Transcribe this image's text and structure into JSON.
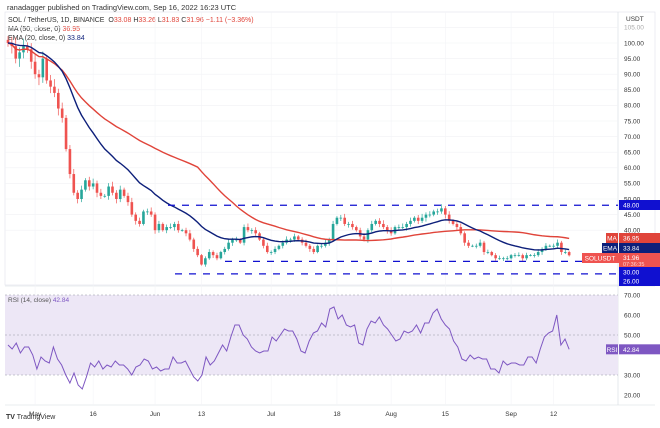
{
  "header": {
    "published": "ranadagger published on TradingView.com, Sep 16, 2022 16:23 UTC",
    "symbol": "SOL / TetherUS, 1D, BINANCE",
    "o_label": "O",
    "o": "33.08",
    "h_label": "H",
    "h": "33.26",
    "l_label": "L",
    "l": "31.83",
    "c_label": "C",
    "c": "31.96",
    "change": "−1.11 (−3.36%)",
    "ma_legend": "MA (50, close, 0)",
    "ma_value": "36.95",
    "ema_legend": "EMA (20, close, 0)",
    "ema_value": "33.84"
  },
  "footer": {
    "brand": "TradingView"
  },
  "colors": {
    "up": "#26a69a",
    "down": "#ef5350",
    "ma": "#e0443a",
    "ema": "#0d1f7a",
    "level": "#1010d0",
    "rsi": "#7e57c2",
    "rsi_band": "#ede7f6"
  },
  "chart_data": [
    {
      "type": "candlestick",
      "title": "SOL / TetherUS, 1D, BINANCE",
      "ylabel": "USDT",
      "ylim": [
        26,
        107
      ],
      "y_ticks": [
        "105.00",
        "100.00",
        "95.00",
        "90.00",
        "85.00",
        "80.00",
        "75.00",
        "70.00",
        "65.00",
        "60.00",
        "55.00",
        "50.00",
        "45.00",
        "40.00"
      ],
      "x_ticks": [
        "May",
        "16",
        "Jun",
        "13",
        "Jul",
        "18",
        "Aug",
        "15",
        "Sep",
        "12"
      ],
      "closes": [
        100,
        99,
        95,
        97,
        99,
        98,
        94,
        90,
        89,
        95,
        88,
        86,
        84,
        79,
        76,
        66,
        58,
        52,
        50,
        53,
        56,
        54,
        55,
        52,
        51,
        51,
        54,
        52,
        50,
        53,
        51,
        49,
        45,
        43,
        42,
        46,
        46,
        45,
        40,
        42,
        40,
        41,
        41,
        42,
        40,
        40,
        39,
        37,
        34,
        32,
        29,
        31,
        33,
        32,
        31,
        33,
        34,
        36,
        37,
        37,
        36,
        41,
        40,
        40,
        39,
        37,
        35,
        33,
        33,
        34,
        35,
        36,
        37,
        37,
        38,
        37,
        36,
        35,
        34,
        33,
        35,
        35,
        36,
        37,
        42,
        44,
        44,
        42,
        42,
        41,
        40,
        38,
        37,
        40,
        42,
        43,
        42,
        41,
        40,
        39,
        41,
        41,
        41,
        42,
        43,
        44,
        43,
        44,
        45,
        45,
        46,
        46,
        47,
        45,
        43,
        42,
        41,
        39,
        36,
        35,
        35,
        35,
        36,
        33,
        33,
        32,
        31,
        31,
        31,
        31,
        32,
        32,
        32,
        31,
        32,
        32,
        32,
        33,
        34,
        35,
        35,
        35,
        36,
        33,
        33,
        31.96
      ],
      "series": [
        {
          "name": "MA",
          "type": "sma",
          "period": 50
        },
        {
          "name": "EMA",
          "type": "ema",
          "period": 20
        }
      ],
      "horizontal_levels": [
        48,
        30,
        26
      ],
      "badges": [
        {
          "label": "MA",
          "value": "36.95"
        },
        {
          "label": "EMA",
          "value": "33.84"
        },
        {
          "label": "SOLUSDT",
          "value": "31.96",
          "countdown": "07:36:35"
        },
        {
          "value": "48.00"
        },
        {
          "value": "30.00"
        },
        {
          "value": "26.00"
        }
      ]
    },
    {
      "type": "line",
      "title": "RSI (14, close)",
      "last_value": "42.84",
      "badge_label": "RSI",
      "ylim": [
        18,
        72
      ],
      "band": [
        30,
        70
      ],
      "midline": 50,
      "y_ticks": [
        "70.00",
        "60.00",
        "50.00",
        "40.00",
        "30.00",
        "20.00"
      ],
      "values": [
        45,
        43,
        46,
        41,
        44,
        44,
        40,
        33,
        39,
        37,
        36,
        44,
        38,
        35,
        30,
        26,
        31,
        25,
        23,
        29,
        36,
        34,
        37,
        33,
        35,
        34,
        37,
        35,
        35,
        33,
        30,
        34,
        35,
        38,
        37,
        33,
        34,
        32,
        33,
        33,
        39,
        36,
        36,
        37,
        33,
        29,
        27,
        30,
        39,
        35,
        37,
        41,
        45,
        42,
        49,
        55,
        55,
        50,
        48,
        44,
        42,
        41,
        42,
        42,
        49,
        47,
        50,
        53,
        52,
        52,
        48,
        42,
        41,
        47,
        51,
        52,
        56,
        54,
        63,
        64,
        58,
        60,
        55,
        54,
        55,
        46,
        45,
        53,
        57,
        56,
        59,
        55,
        53,
        50,
        47,
        48,
        52,
        51,
        52,
        55,
        51,
        56,
        56,
        61,
        63,
        58,
        55,
        53,
        47,
        44,
        38,
        37,
        40,
        38,
        39,
        38,
        38,
        33,
        33,
        31,
        37,
        35,
        36,
        36,
        35,
        35,
        39,
        39,
        36,
        43,
        49,
        51,
        52,
        60,
        45,
        48,
        42.84
      ]
    }
  ]
}
